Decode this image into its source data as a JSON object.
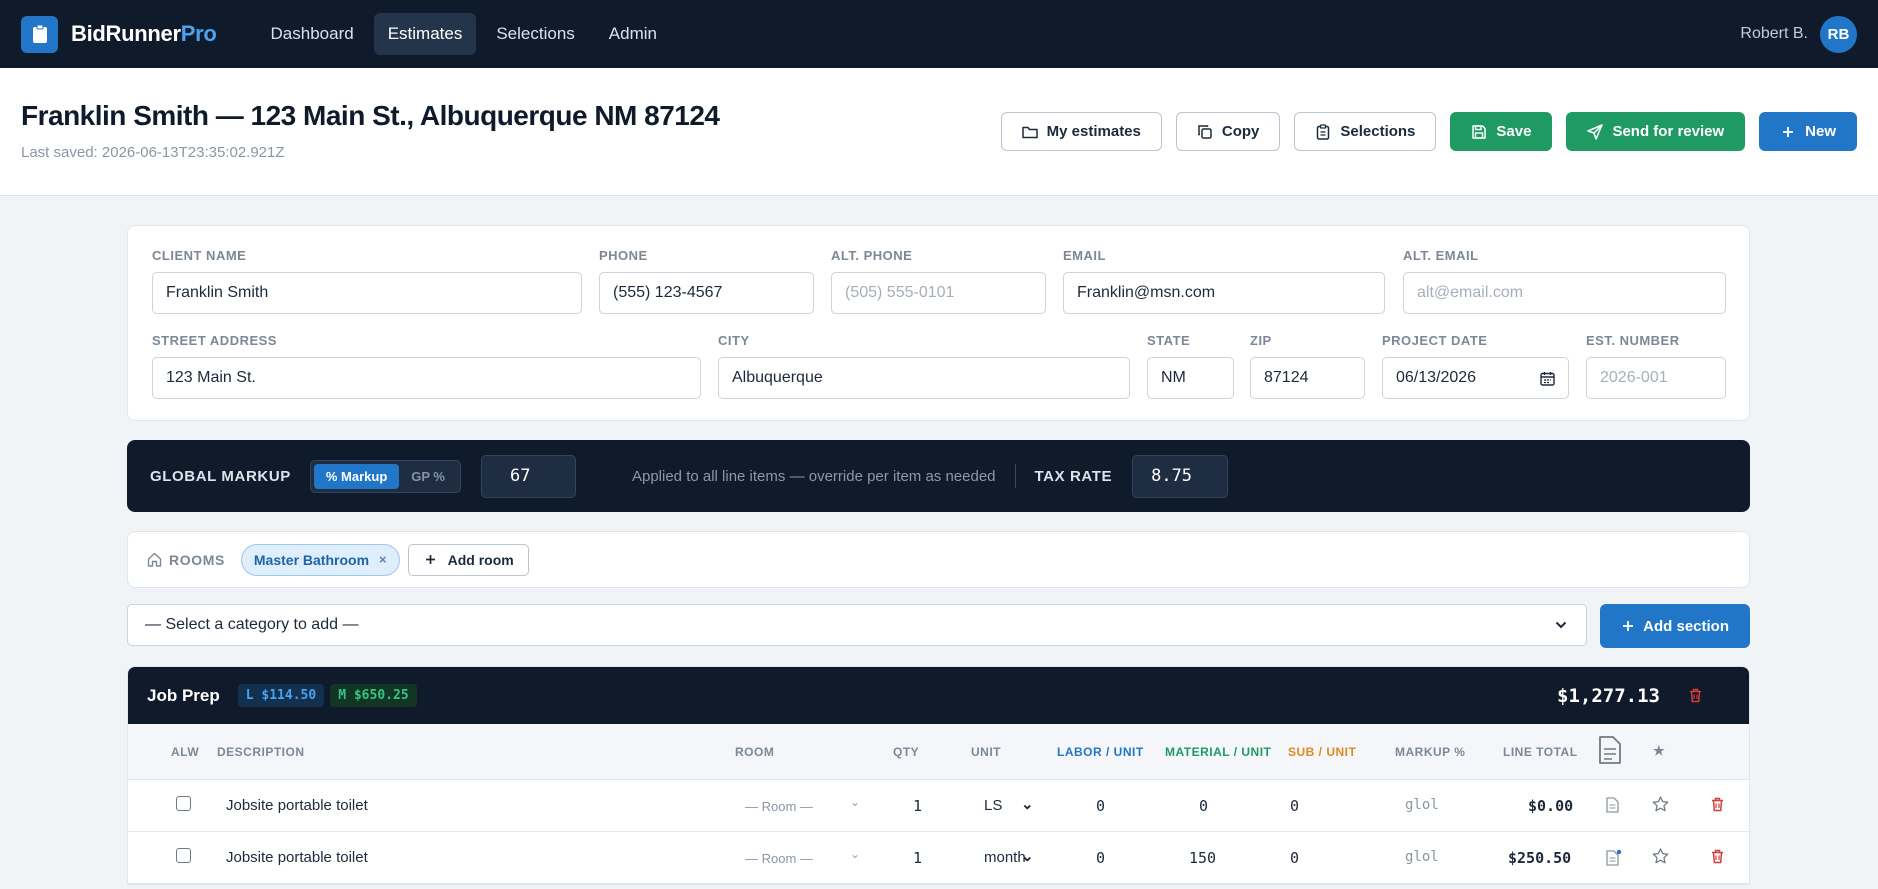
{
  "nav": {
    "brand_main": "BidRunner",
    "brand_accent": "Pro",
    "links": [
      "Dashboard",
      "Estimates",
      "Selections",
      "Admin"
    ],
    "user_name": "Robert B.",
    "user_initials": "RB"
  },
  "header": {
    "title": "Franklin Smith — 123 Main St., Albuquerque NM 87124",
    "last_saved": "Last saved: 2026-06-13T23:35:02.921Z",
    "actions": {
      "my_estimates": "My estimates",
      "copy": "Copy",
      "selections": "Selections",
      "save": "Save",
      "send_for_review": "Send for review",
      "new": "New"
    }
  },
  "client": {
    "client_name": {
      "label": "CLIENT NAME",
      "value": "Franklin Smith"
    },
    "phone": {
      "label": "PHONE",
      "value": "(555) 123-4567"
    },
    "alt_phone": {
      "label": "ALT. PHONE",
      "placeholder": "(505) 555-0101"
    },
    "email": {
      "label": "EMAIL",
      "value": "Franklin@msn.com"
    },
    "alt_email": {
      "label": "ALT. EMAIL",
      "placeholder": "alt@email.com"
    },
    "street": {
      "label": "STREET ADDRESS",
      "value": "123 Main St."
    },
    "city": {
      "label": "CITY",
      "value": "Albuquerque"
    },
    "state": {
      "label": "STATE",
      "value": "NM"
    },
    "zip": {
      "label": "ZIP",
      "value": "87124"
    },
    "project_date": {
      "label": "PROJECT DATE",
      "value": "06/13/2026"
    },
    "est_number": {
      "label": "EST. NUMBER",
      "placeholder": "2026-001"
    }
  },
  "markup": {
    "label": "GLOBAL MARKUP",
    "toggle_markup": "% Markup",
    "toggle_gp": "GP %",
    "value": "67",
    "note": "Applied to all line items — override per item as needed",
    "tax_label": "TAX RATE",
    "tax_value": "8.75"
  },
  "rooms": {
    "label": "ROOMS",
    "chips": [
      "Master Bathroom"
    ],
    "add_label": "Add room"
  },
  "category": {
    "select_value": "— Select a category to add —",
    "add_section_label": "Add section"
  },
  "section": {
    "title": "Job Prep",
    "labor_pill": "L $114.50",
    "material_pill": "M $650.25",
    "total": "$1,277.13",
    "columns": {
      "alw": "ALW",
      "description": "DESCRIPTION",
      "room": "ROOM",
      "qty": "QTY",
      "unit": "UNIT",
      "labor": "LABOR / UNIT",
      "material": "MATERIAL / UNIT",
      "sub": "SUB / UNIT",
      "markup": "MARKUP %",
      "line_total": "LINE TOTAL"
    },
    "rows": [
      {
        "description": "Jobsite portable toilet",
        "room": "— Room —",
        "qty": "1",
        "unit": "LS",
        "labor": "0",
        "material": "0",
        "sub": "0",
        "markup": "glol",
        "line_total": "$0.00"
      },
      {
        "description": "Jobsite portable toilet",
        "room": "— Room —",
        "qty": "1",
        "unit": "month",
        "labor": "0",
        "material": "150",
        "sub": "0",
        "markup": "glol",
        "line_total": "$250.50"
      }
    ]
  },
  "colors": {
    "navy": "#0f1b2b",
    "accent_blue": "#2276c8",
    "green": "#1f9a63",
    "danger": "#d63b3b",
    "sub_orange": "#e08a1e"
  }
}
